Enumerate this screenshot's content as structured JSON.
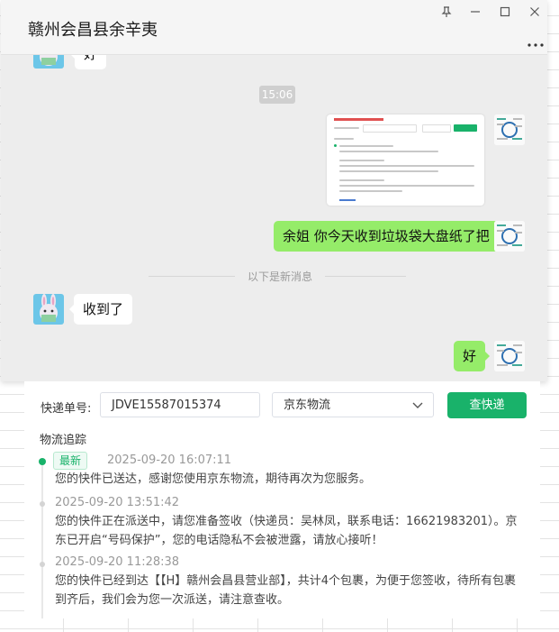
{
  "window": {
    "title": "赣州会昌县余辛夷",
    "controls": {
      "pin": "pin-icon",
      "minimize": "minimize-icon",
      "maximize": "maximize-icon",
      "close": "close-icon",
      "more": "more-icon"
    }
  },
  "chat": {
    "messages": [
      {
        "side": "left",
        "text": "好",
        "partial": true
      },
      {
        "side": "time",
        "text": "15:06"
      },
      {
        "side": "right",
        "type": "image",
        "caption": "screenshot"
      },
      {
        "side": "right",
        "text": "余姐 你今天收到垃圾袋大盘纸了把"
      },
      {
        "side": "divider",
        "text": "以下是新消息"
      },
      {
        "side": "left",
        "text": "收到了"
      },
      {
        "side": "right",
        "text": "好"
      }
    ]
  },
  "tracking": {
    "number_label": "快递单号:",
    "number_value": "JDVE15587015374",
    "carrier_value": "京东物流",
    "query_button": "查快递",
    "section_title": "物流追踪",
    "events": [
      {
        "tag": "最新",
        "time": "2025-09-20 16:07:11",
        "text": "您的快件已送达，感谢您使用京东物流，期待再次为您服务。"
      },
      {
        "time": "2025-09-20 13:51:42",
        "text": "您的快件正在派送中，请您准备签收（快递员：吴林凤，联系电话：16621983201）。京东已开启“号码保护”，您的电话隐私不会被泄露，请放心接听！"
      },
      {
        "time": "2025-09-20 11:28:38",
        "text": "您的快件已经到达【【H】赣州会昌县营业部】，共计4个包裹，为便于您签收，待所有包裹到齐后，我们会为您一次派送，请注意查收。"
      }
    ]
  },
  "colors": {
    "accent": "#19b26a",
    "bubble_me": "#95ec69",
    "bubble_other": "#ffffff",
    "chat_bg": "#ededed"
  }
}
